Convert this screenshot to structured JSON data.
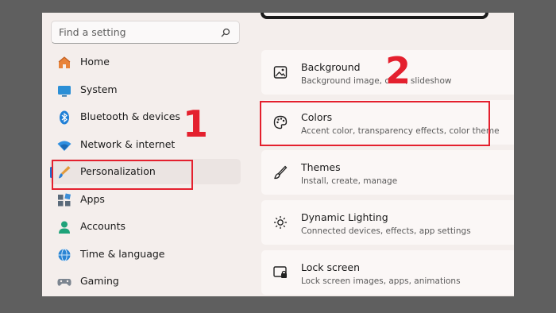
{
  "search": {
    "placeholder": "Find a setting",
    "icon": "search-icon"
  },
  "nav": {
    "items": [
      {
        "label": "Home",
        "icon": "home-icon"
      },
      {
        "label": "System",
        "icon": "system-display-icon"
      },
      {
        "label": "Bluetooth & devices",
        "icon": "bluetooth-icon"
      },
      {
        "label": "Network & internet",
        "icon": "wifi-icon"
      },
      {
        "label": "Personalization",
        "icon": "paintbrush-icon",
        "selected": true
      },
      {
        "label": "Apps",
        "icon": "apps-icon"
      },
      {
        "label": "Accounts",
        "icon": "account-icon"
      },
      {
        "label": "Time & language",
        "icon": "globe-clock-icon"
      },
      {
        "label": "Gaming",
        "icon": "gamepad-icon"
      }
    ]
  },
  "cards": [
    {
      "title": "Background",
      "desc": "Background image, color, slideshow",
      "icon": "image-icon"
    },
    {
      "title": "Colors",
      "desc": "Accent color, transparency effects, color theme",
      "icon": "palette-icon"
    },
    {
      "title": "Themes",
      "desc": "Install, create, manage",
      "icon": "brush-icon"
    },
    {
      "title": "Dynamic Lighting",
      "desc": "Connected devices, effects, app settings",
      "icon": "sun-lighting-icon"
    },
    {
      "title": "Lock screen",
      "desc": "Lock screen images, apps, animations",
      "icon": "lock-screen-icon"
    }
  ],
  "annotations": {
    "step1": "1",
    "step2": "2",
    "color": "#e4202e"
  },
  "colors": {
    "accent": "#1d6fd0",
    "highlight": "#e4202e"
  }
}
